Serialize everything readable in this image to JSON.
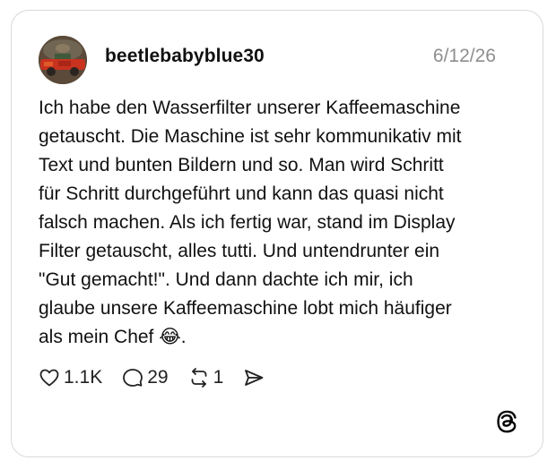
{
  "post": {
    "username": "beetlebabyblue30",
    "date": "6/12/26",
    "text": "Ich habe den Wasserfilter unserer Kaffeemaschine\ngetauscht. Die Maschine ist sehr kommunikativ mit\nText und bunten Bildern und so. Man wird Schritt\nfür Schritt durchgeführt und kann das quasi nicht\nfalsch machen. Als ich fertig war, stand im Display\nFilter getauscht, alles tutti. Und untendrunter ein\n\"Gut gemacht!\". Und dann dachte ich mir, ich\nglaube unsere Kaffeemaschine lobt mich häufiger\nals mein Chef 😂."
  },
  "actions": {
    "likes": "1.1K",
    "replies": "29",
    "reposts": "1"
  },
  "icons": {
    "like": "heart-icon",
    "reply": "speech-bubble-icon",
    "repost": "repost-icon",
    "share": "send-icon",
    "brand": "threads-logo-icon"
  }
}
